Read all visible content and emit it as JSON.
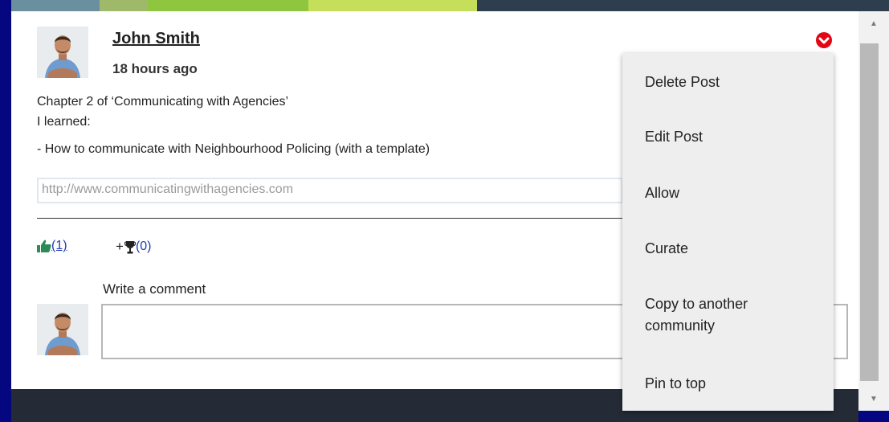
{
  "post": {
    "author": "John Smith",
    "time": "18 hours ago",
    "text_lines": [
      "Chapter 2 of ‘Communicating with Agencies’",
      "I learned:",
      "- How to communicate with Neighbourhood Policing (with a template)"
    ],
    "link": "http://www.communicatingwithagencies.com"
  },
  "reactions": {
    "like_icon": "thumbs-up-icon",
    "likes": "(1)",
    "trophy_prefix": "+",
    "trophy_icon": "trophy-icon",
    "trophies": "(0)"
  },
  "comment": {
    "label": "Write a comment",
    "value": "",
    "placeholder": ""
  },
  "menu": {
    "items": [
      {
        "label": "Delete Post"
      },
      {
        "label": "Edit Post"
      },
      {
        "label": "Allow"
      },
      {
        "label": "Curate"
      },
      {
        "label": "Copy to another community"
      },
      {
        "label": "Pin to top"
      }
    ]
  },
  "icons": {
    "options": "chevron-down-circle-icon",
    "avatar": "avatar-photo"
  },
  "colors": {
    "page_background": "#04077f",
    "card_background": "#ffffff",
    "menu_background": "#eeeeee",
    "accent_red": "#e30613",
    "link_blue": "#1f3bb3",
    "like_green": "#2e8b57",
    "footer_band": "#242b36"
  }
}
